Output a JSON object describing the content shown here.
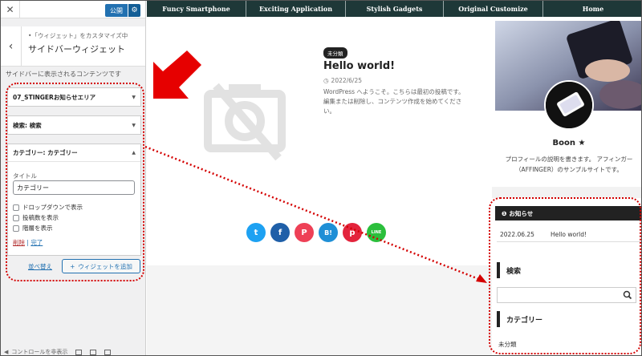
{
  "panel": {
    "close_icon": "close-icon",
    "publish_label": "公開",
    "gear_icon": "gear-icon",
    "crumb": "•「ウィジェット」をカスタマイズ中",
    "section_title": "サイドバーウィジェット",
    "area_desc": "サイドバーに表示されるコンテンツです",
    "widgets": [
      {
        "title": "07_STINGERお知らせエリア"
      },
      {
        "title": "検索: 検索"
      },
      {
        "title": "カテゴリー: カテゴリー"
      }
    ],
    "title_label": "タイトル",
    "title_value": "カテゴリー",
    "checkboxes": [
      "ドロップダウンで表示",
      "投稿数を表示",
      "階層を表示"
    ],
    "delete_link": "削除",
    "separator": "|",
    "done_link": "完了",
    "reorder_link": "並べ替え",
    "add_widget_label": "ウィジェットを追加",
    "footer_label": "コントロールを非表示"
  },
  "nav": {
    "items": [
      "Funcy Smartphone",
      "Exciting Application",
      "Stylish Gadgets",
      "Original Customize",
      "Home"
    ]
  },
  "post": {
    "category": "未分類",
    "title": "Hello world!",
    "date": "2022/6/25",
    "excerpt": "WordPress へようこそ。こちらは最初の投稿です。編集または削除し、コンテンツ作成を始めてください。"
  },
  "share": {
    "twitter": "t",
    "facebook": "f",
    "pocket": "P",
    "hatena": "B!",
    "pinterest": "p",
    "line": "LINE"
  },
  "sidebar": {
    "profile_name": "Boon ★",
    "profile_desc": "プロフィールの説明を書きます。 アフィンガー（AFFINGER）のサンプルサイトです。",
    "notice_title": "お知らせ",
    "notice_date": "2022.06.25",
    "notice_text": "Hello world!",
    "search_heading": "検索",
    "category_heading": "カテゴリー",
    "category_item": "未分類"
  },
  "colors": {
    "nav_bg": "#1e3838",
    "accent_blue": "#2271b1",
    "annotation_red": "#d40000"
  }
}
